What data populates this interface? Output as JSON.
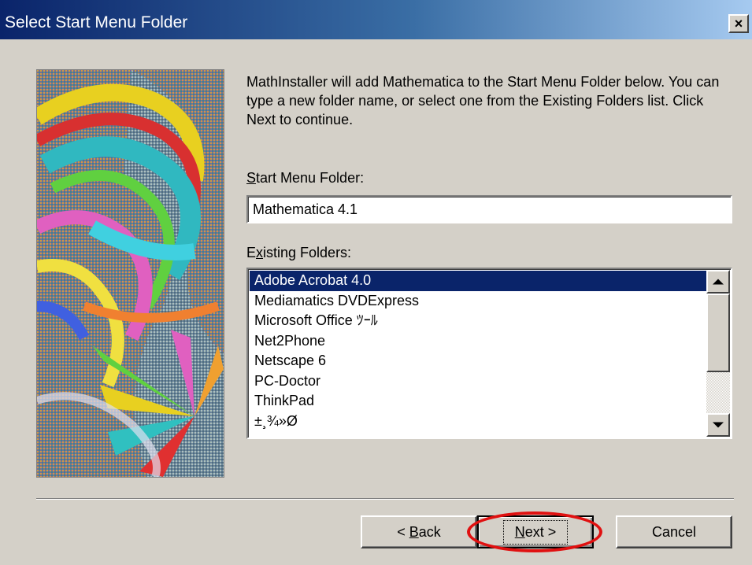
{
  "window": {
    "title": "Select Start Menu Folder",
    "close_label": "×"
  },
  "description": "MathInstaller will add Mathematica to the Start Menu Folder below.  You can type a new folder name, or select one from the Existing Folders list.  Click Next to continue.",
  "start_menu_folder": {
    "label_mnemonic": "S",
    "label_rest": "tart Menu Folder:",
    "value": "Mathematica 4.1"
  },
  "existing_folders": {
    "label_before": "E",
    "label_mnemonic": "x",
    "label_rest": "isting Folders:",
    "items": [
      "Adobe Acrobat 4.0",
      "Mediamatics DVDExpress",
      "Microsoft Office ﾂｰﾙ",
      "Net2Phone",
      "Netscape 6",
      "PC-Doctor",
      "ThinkPad",
      "±¸¾»Ø"
    ],
    "selected_index": 0
  },
  "buttons": {
    "back_prefix": "< ",
    "back_mnemonic": "B",
    "back_rest": "ack",
    "next_mnemonic": "N",
    "next_rest": "ext >",
    "cancel": "Cancel"
  },
  "colors": {
    "title_bar": "#0a246a",
    "selection": "#0a246a",
    "dialog_bg": "#d4d0c8",
    "annotation_ring": "#e01010"
  }
}
